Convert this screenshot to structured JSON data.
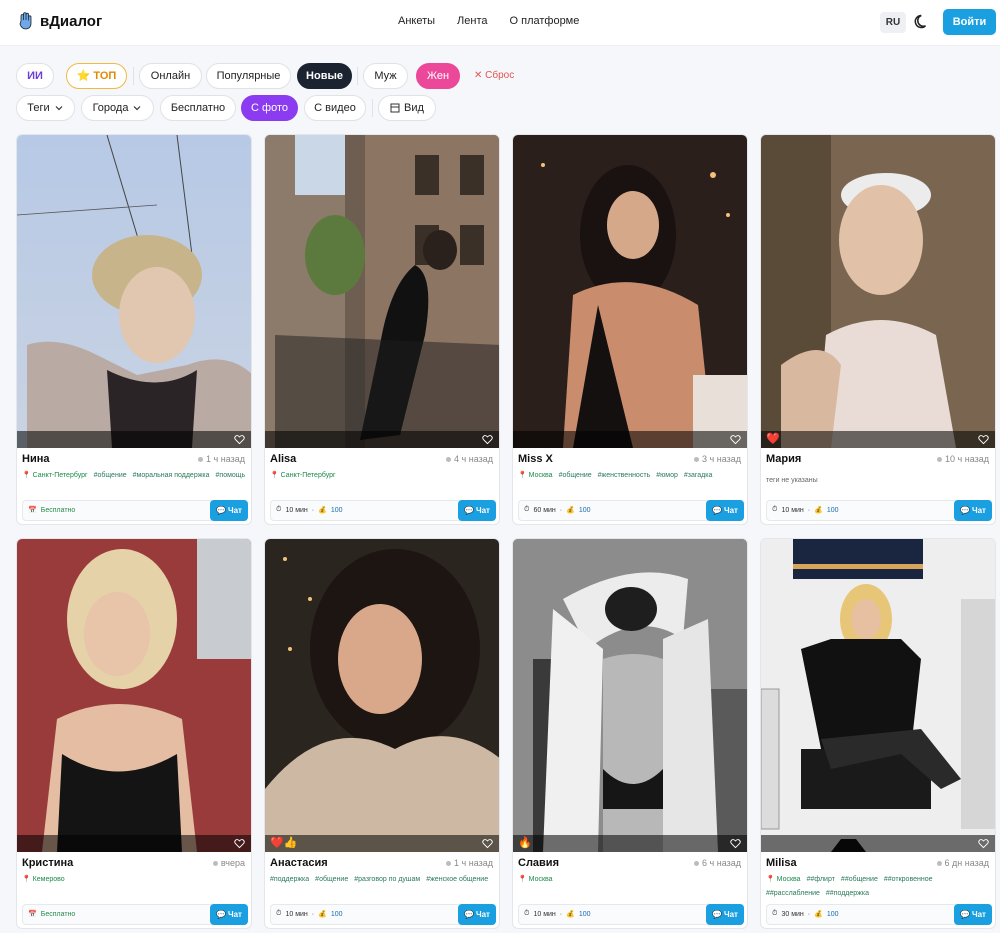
{
  "header": {
    "brand": "вДиалог",
    "nav": [
      "Анкеты",
      "Лента",
      "О платформе"
    ],
    "lang": "RU",
    "login_label": "Войти"
  },
  "filters": {
    "row1": [
      "ИИ",
      "⭐ ТОП",
      "Онлайн",
      "Популярные",
      "Новые",
      "Муж",
      "Жен"
    ],
    "reset": "✕ Сброс",
    "row2": [
      "Теги",
      "Города",
      "Бесплатно",
      "С фото",
      "С видео",
      "Вид"
    ]
  },
  "colors": {
    "accent": "#1a9fe0",
    "pink": "#ec4899",
    "purple": "#8b3cf0",
    "dark": "#1c2330"
  },
  "cards": [
    {
      "name": "Нина",
      "time": "1 ч назад",
      "emoji": "",
      "city": "Санкт-Петербург",
      "tags": [
        "#общение",
        "#моральная поддержка",
        "#помощь"
      ],
      "price_type": "free",
      "price": "Бесплатно",
      "chat": "Чат"
    },
    {
      "name": "Alisa",
      "time": "4 ч назад",
      "emoji": "",
      "city": "Санкт-Петербург",
      "tags": [],
      "price_type": "paid",
      "duration": "10 мин",
      "cost": "100",
      "chat": "Чат"
    },
    {
      "name": "Miss X",
      "time": "3 ч назад",
      "emoji": "",
      "city": "Москва",
      "tags": [
        "#общение",
        "#женственность",
        "#юмор",
        "#загадка"
      ],
      "price_type": "paid",
      "duration": "60 мин",
      "cost": "100",
      "chat": "Чат"
    },
    {
      "name": "Мария",
      "time": "10 ч назад",
      "emoji": "❤️",
      "city": "",
      "tags": [],
      "no_tags": "теги не указаны",
      "price_type": "paid",
      "duration": "10 мин",
      "cost": "100",
      "chat": "Чат"
    },
    {
      "name": "Кристина",
      "time": "вчера",
      "emoji": "",
      "city": "Кемерово",
      "tags": [],
      "price_type": "free",
      "price": "Бесплатно",
      "chat": "Чат"
    },
    {
      "name": "Анастасия",
      "time": "1 ч назад",
      "emoji": "❤️👍",
      "city": "",
      "tags": [
        "#поддержка",
        "#общение",
        "#разговор по душам",
        "#женское общение"
      ],
      "price_type": "paid",
      "duration": "10 мин",
      "cost": "100",
      "chat": "Чат"
    },
    {
      "name": "Славия",
      "time": "6 ч назад",
      "emoji": "🔥",
      "city": "Москва",
      "tags": [],
      "price_type": "paid",
      "duration": "10 мин",
      "cost": "100",
      "chat": "Чат"
    },
    {
      "name": "Milisa",
      "time": "6 дн назад",
      "emoji": "",
      "city": "Москва",
      "tags": [
        "##флирт",
        "##общение",
        "##откровенное",
        "##расслабление",
        "##поддержка"
      ],
      "price_type": "paid",
      "duration": "30 мин",
      "cost": "100",
      "chat": "Чат"
    }
  ]
}
